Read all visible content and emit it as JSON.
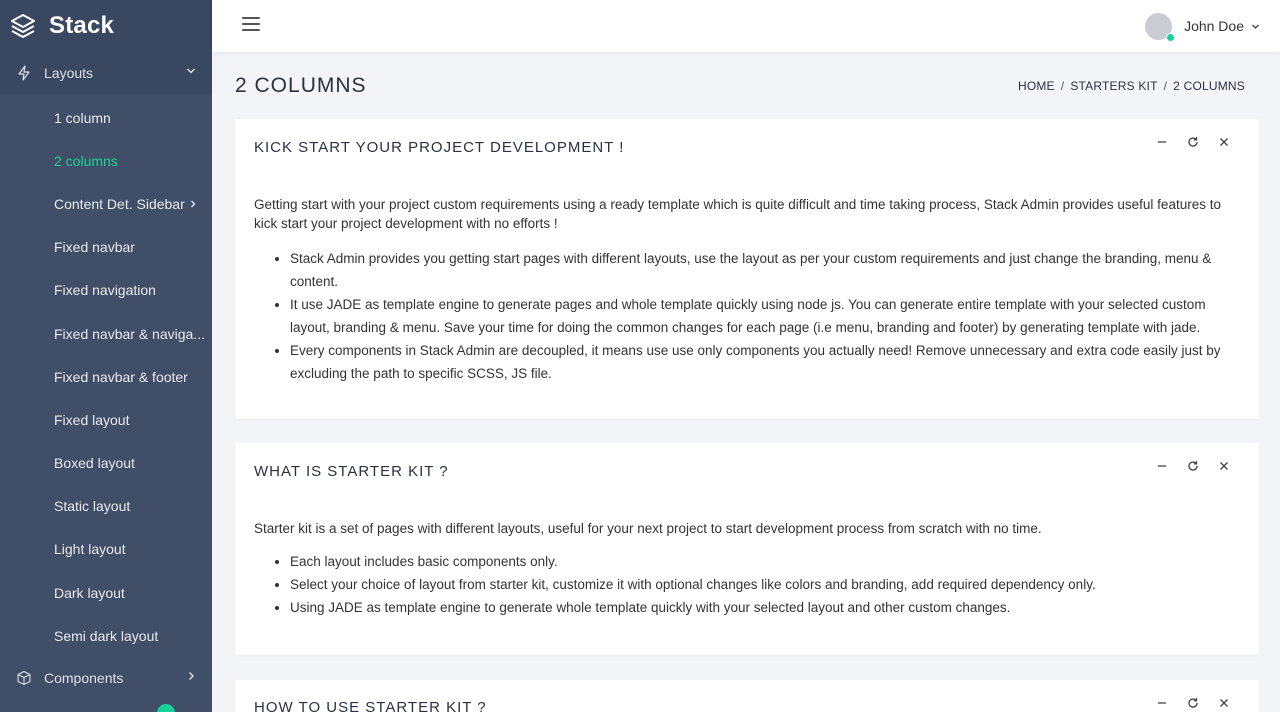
{
  "brand": {
    "name": "Stack"
  },
  "sidebar": {
    "groups": [
      {
        "label": "Layouts",
        "icon": "lightning-icon"
      },
      {
        "label": "Components",
        "icon": "cube-icon"
      }
    ],
    "items": [
      {
        "label": "1 column"
      },
      {
        "label": "2 columns"
      },
      {
        "label": "Content Det. Sidebar"
      },
      {
        "label": "Fixed navbar"
      },
      {
        "label": "Fixed navigation"
      },
      {
        "label": "Fixed navbar & naviga..."
      },
      {
        "label": "Fixed navbar & footer"
      },
      {
        "label": "Fixed layout"
      },
      {
        "label": "Boxed layout"
      },
      {
        "label": "Static layout"
      },
      {
        "label": "Light layout"
      },
      {
        "label": "Dark layout"
      },
      {
        "label": "Semi dark layout"
      }
    ],
    "active_item": "2 columns"
  },
  "header": {
    "user_name": "John Doe"
  },
  "page": {
    "title": "2 COLUMNS",
    "breadcrumb": [
      "HOME",
      "STARTERS KIT",
      "2 COLUMNS"
    ]
  },
  "cards": [
    {
      "title": "KICK START YOUR PROJECT DEVELOPMENT !",
      "intro": "Getting start with your project custom requirements using a ready template which is quite difficult and time taking process, Stack Admin provides useful features to kick start your project development with no efforts !",
      "bullets": [
        "Stack Admin provides you getting start pages with different layouts, use the layout as per your custom requirements and just change the branding, menu & content.",
        "It use JADE as template engine to generate pages and whole template quickly using node js. You can generate entire template with your selected custom layout, branding & menu. Save your time for doing the common changes for each page (i.e menu, branding and footer) by generating template with jade.",
        "Every components in Stack Admin are decoupled, it means use use only components you actually need! Remove unnecessary and extra code easily just by excluding the path to specific SCSS, JS file."
      ]
    },
    {
      "title": "WHAT IS STARTER KIT ?",
      "intro": "Starter kit is a set of pages with different layouts, useful for your next project to start development process from scratch with no time.",
      "bullets": [
        "Each layout includes basic components only.",
        "Select your choice of layout from starter kit, customize it with optional changes like colors and branding, add required dependency only.",
        "Using JADE as template engine to generate whole template quickly with your selected layout and other custom changes."
      ]
    },
    {
      "title": "HOW TO USE STARTER KIT ?"
    }
  ],
  "colors": {
    "sidebar_bg": "#404e67",
    "accent": "#16d39a",
    "page_bg": "#f3f4f7"
  }
}
